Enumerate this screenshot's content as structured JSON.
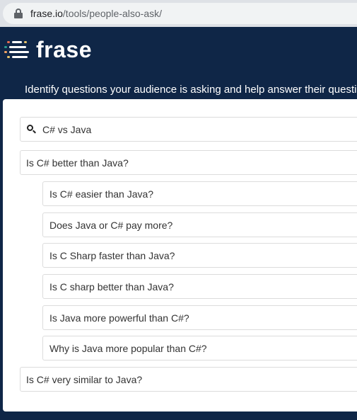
{
  "browser": {
    "url_domain": "frase.io",
    "url_path": "/tools/people-also-ask/"
  },
  "header": {
    "logo_text": "frase",
    "tagline": "Identify questions your audience is asking and help answer their questi"
  },
  "search": {
    "value": "C# vs Java"
  },
  "questions": [
    {
      "text": "Is C# better than Java?",
      "level": 1
    },
    {
      "text": "Is C# easier than Java?",
      "level": 2
    },
    {
      "text": "Does Java or C# pay more?",
      "level": 2
    },
    {
      "text": "Is C Sharp faster than Java?",
      "level": 2
    },
    {
      "text": "Is C sharp better than Java?",
      "level": 2
    },
    {
      "text": "Is Java more powerful than C#?",
      "level": 2
    },
    {
      "text": "Why is Java more popular than C#?",
      "level": 2
    },
    {
      "text": "Is C# very similar to Java?",
      "level": 1
    }
  ],
  "colors": {
    "brand_navy": "#0f2647",
    "logo_accents": [
      "#f4a261",
      "#e76f51",
      "#2a9d8f",
      "#e9c46a"
    ]
  }
}
